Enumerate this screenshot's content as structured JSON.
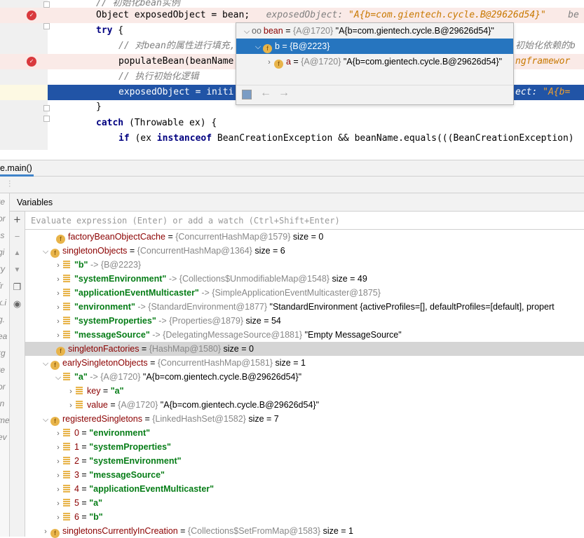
{
  "editor": {
    "lines": [
      {
        "kind": "comment",
        "indent": 0,
        "text": "// 初始化bean实例"
      },
      {
        "kind": "bp",
        "indent": 0,
        "code": "Object exposedObject = bean;",
        "hint_label": "exposedObject: ",
        "hint_value": "\"A{b=com.gientech.cycle.B@29626d54}\"",
        "hint_extra": "be"
      },
      {
        "kind": "try",
        "indent": 0,
        "kw": "try",
        "rest": " {"
      },
      {
        "kind": "comment",
        "indent": 1,
        "text": "// 对bean的属性进行填充,",
        "text_right": "初始化依赖的b"
      },
      {
        "kind": "bp",
        "indent": 1,
        "code": "populateBean(beanName",
        "hint_value": "ngframewor"
      },
      {
        "kind": "comment",
        "indent": 1,
        "text": "// 执行初始化逻辑"
      },
      {
        "kind": "cur",
        "indent": 1,
        "code": "exposedObject = initi",
        "hint_label": "ect: ",
        "hint_value": "\"A{b="
      },
      {
        "kind": "plain",
        "indent": 0,
        "code": "}"
      },
      {
        "kind": "catch",
        "indent": 0,
        "kw": "catch",
        "rest": " (Throwable ex) {"
      },
      {
        "kind": "if",
        "indent": 1,
        "kw": "if",
        "rest1": " (ex ",
        "kw2": "instanceof",
        "rest2": " BeanCreationException && beanName.equals(((BeanCreationException)"
      }
    ]
  },
  "popup": {
    "rows": [
      {
        "expanded": true,
        "icon": "watch-icon",
        "name": "bean",
        "ref": "{A@1720}",
        "value": "\"A{b=com.gientech.cycle.B@29626d54}\""
      },
      {
        "expanded": true,
        "icon": "field-icon",
        "name": "b",
        "ref": "{B@2223}",
        "value": "",
        "selected": true
      },
      {
        "expanded": false,
        "icon": "field-icon",
        "name": "a",
        "ref": "{A@1720}",
        "value": "\"A{b=com.gientech.cycle.B@29626d54}\""
      }
    ]
  },
  "debug": {
    "tab_label": "e.main()",
    "variables_title": "Variables",
    "watch_placeholder": "Evaluate expression (Enter) or add a watch (Ctrl+Shift+Enter)",
    "frames": [
      "te",
      "or",
      ".s",
      "gi",
      "ry",
      "fr",
      "k.i",
      "g.",
      "ea",
      "rg",
      "te",
      "or",
      "in",
      "me",
      "ev"
    ]
  },
  "tree": [
    {
      "level": 0,
      "toggle": "none",
      "icon": "field",
      "name": "factoryBeanObjectCache",
      "ref": "{ConcurrentHashMap@1579}",
      "extra": "size = 0"
    },
    {
      "level": 0,
      "toggle": "open",
      "icon": "field",
      "name": "singletonObjects",
      "ref": "{ConcurrentHashMap@1364}",
      "extra": "size = 6"
    },
    {
      "level": 1,
      "toggle": "closed",
      "icon": "entry",
      "key": "\"b\"",
      "ref": "{B@2223}",
      "extra": ""
    },
    {
      "level": 1,
      "toggle": "closed",
      "icon": "entry",
      "key": "\"systemEnvironment\"",
      "ref": "{Collections$UnmodifiableMap@1548}",
      "extra": "size = 49"
    },
    {
      "level": 1,
      "toggle": "closed",
      "icon": "entry",
      "key": "\"applicationEventMulticaster\"",
      "ref": "{SimpleApplicationEventMulticaster@1875}",
      "extra": ""
    },
    {
      "level": 1,
      "toggle": "closed",
      "icon": "entry",
      "key": "\"environment\"",
      "ref": "{StandardEnvironment@1877}",
      "extra": "\"StandardEnvironment {activeProfiles=[], defaultProfiles=[default], propert"
    },
    {
      "level": 1,
      "toggle": "closed",
      "icon": "entry",
      "key": "\"systemProperties\"",
      "ref": "{Properties@1879}",
      "extra": "size = 54"
    },
    {
      "level": 1,
      "toggle": "closed",
      "icon": "entry",
      "key": "\"messageSource\"",
      "ref": "{DelegatingMessageSource@1881}",
      "extra": "\"Empty MessageSource\""
    },
    {
      "level": 0,
      "toggle": "none",
      "icon": "field",
      "name": "singletonFactories",
      "ref": "{HashMap@1580}",
      "extra": "size = 0",
      "highlight": true
    },
    {
      "level": 0,
      "toggle": "open",
      "icon": "field",
      "name": "earlySingletonObjects",
      "ref": "{ConcurrentHashMap@1581}",
      "extra": "size = 1"
    },
    {
      "level": 1,
      "toggle": "open",
      "icon": "entry",
      "key": "\"a\"",
      "ref": "{A@1720}",
      "extra": "\"A{b=com.gientech.cycle.B@29626d54}\""
    },
    {
      "level": 2,
      "toggle": "closed",
      "icon": "entry",
      "name": "key",
      "value": "\"a\""
    },
    {
      "level": 2,
      "toggle": "closed",
      "icon": "entry",
      "name": "value",
      "ref": "{A@1720}",
      "extra": "\"A{b=com.gientech.cycle.B@29626d54}\""
    },
    {
      "level": 0,
      "toggle": "open",
      "icon": "field",
      "name": "registeredSingletons",
      "ref": "{LinkedHashSet@1582}",
      "extra": "size = 7"
    },
    {
      "level": 1,
      "toggle": "closed",
      "icon": "entry",
      "name": "0",
      "value": "\"environment\""
    },
    {
      "level": 1,
      "toggle": "closed",
      "icon": "entry",
      "name": "1",
      "value": "\"systemProperties\""
    },
    {
      "level": 1,
      "toggle": "closed",
      "icon": "entry",
      "name": "2",
      "value": "\"systemEnvironment\""
    },
    {
      "level": 1,
      "toggle": "closed",
      "icon": "entry",
      "name": "3",
      "value": "\"messageSource\""
    },
    {
      "level": 1,
      "toggle": "closed",
      "icon": "entry",
      "name": "4",
      "value": "\"applicationEventMulticaster\""
    },
    {
      "level": 1,
      "toggle": "closed",
      "icon": "entry",
      "name": "5",
      "value": "\"a\""
    },
    {
      "level": 1,
      "toggle": "closed",
      "icon": "entry",
      "name": "6",
      "value": "\"b\""
    },
    {
      "level": 0,
      "toggle": "closed",
      "icon": "field",
      "name": "singletonsCurrentlyInCreation",
      "ref": "{Collections$SetFromMap@1583}",
      "extra": "size = 1"
    }
  ],
  "colors": {
    "selection": "#2675bf",
    "current_line": "#2154a6",
    "breakpoint_line": "#faeae7",
    "breakpoint": "#d9393d",
    "field_name": "#8b0000",
    "string_key": "#067d17"
  }
}
